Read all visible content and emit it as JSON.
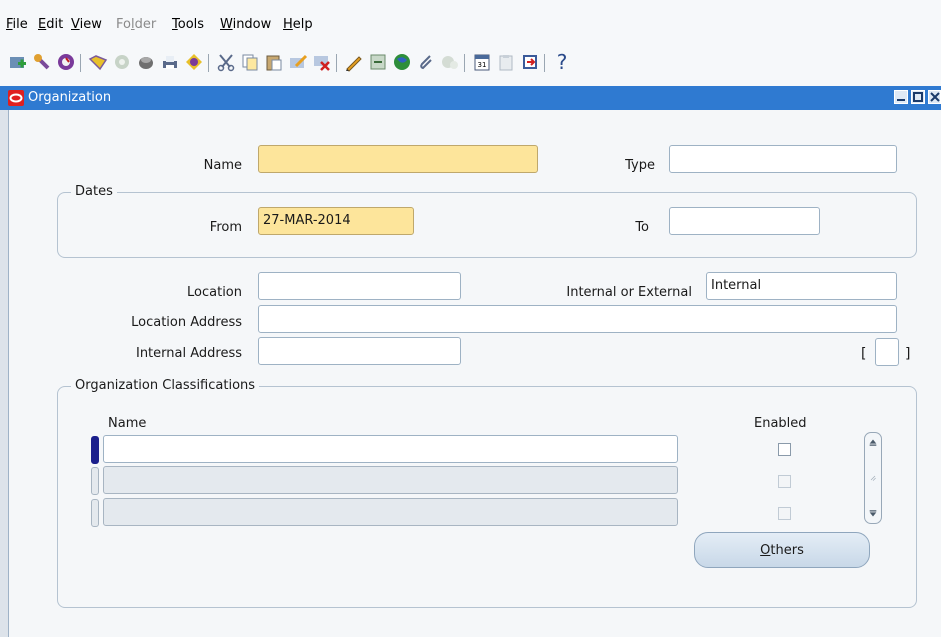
{
  "menu": {
    "file": "File",
    "edit": "Edit",
    "view": "View",
    "folder": "Folder",
    "tools": "Tools",
    "window": "Window",
    "help": "Help"
  },
  "toolbar": {
    "icons": [
      "new-record-icon",
      "find-icon",
      "navigator-icon",
      "open-folder-icon",
      "save-and-proceed-icon",
      "save-icon",
      "print-icon",
      "close-form-icon",
      "cut-icon",
      "copy-icon",
      "paste-icon",
      "clear-record-icon",
      "delete-record-icon",
      "edit-field-icon",
      "zoom-icon",
      "translations-icon",
      "attachments-icon",
      "folder-tools-icon",
      "calendar-icon",
      "clipboard-icon",
      "export-icon",
      "help-icon"
    ],
    "help_label": "?"
  },
  "window": {
    "title": "Organization",
    "accent": "#2f7ad1"
  },
  "form": {
    "name_label": "Name",
    "name_value": "",
    "type_label": "Type",
    "type_value": "",
    "dates_group_title": "Dates",
    "from_label": "From",
    "from_value": "27-MAR-2014",
    "to_label": "To",
    "to_value": "",
    "location_label": "Location",
    "location_value": "",
    "internal_external_label": "Internal or External",
    "internal_external_value": "Internal",
    "location_address_label": "Location Address",
    "location_address_value": "",
    "internal_address_label": "Internal Address",
    "internal_address_value": "",
    "bracket_open": "[",
    "bracket_close": "]"
  },
  "classifications": {
    "group_title": "Organization Classifications",
    "name_header": "Name",
    "enabled_header": "Enabled",
    "rows": [
      {
        "name": "",
        "enabled": false
      },
      {
        "name": "",
        "enabled": false
      },
      {
        "name": "",
        "enabled": false
      }
    ],
    "others_button": "Others",
    "others_mnemonic": "O",
    "others_rest": "thers"
  },
  "colors": {
    "required_field": "#fde59b",
    "title_bar": "#2f7ad1",
    "active_row_marker": "#1b1f8c"
  }
}
